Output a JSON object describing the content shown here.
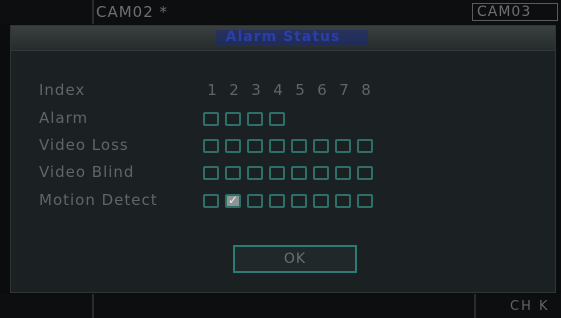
{
  "topbar": {
    "cam_left": "CAM02 *",
    "cam_right": "CAM03"
  },
  "dialog": {
    "title": "Alarm Status",
    "index_label": "Index",
    "indices": [
      "1",
      "2",
      "3",
      "4",
      "5",
      "6",
      "7",
      "8"
    ],
    "rows": [
      {
        "label": "Alarm",
        "checked": [
          false,
          false,
          false,
          false
        ]
      },
      {
        "label": "Video Loss",
        "checked": [
          false,
          false,
          false,
          false,
          false,
          false,
          false,
          false
        ]
      },
      {
        "label": "Video Blind",
        "checked": [
          false,
          false,
          false,
          false,
          false,
          false,
          false,
          false
        ]
      },
      {
        "label": "Motion Detect",
        "checked": [
          false,
          true,
          false,
          false,
          false,
          false,
          false,
          false
        ]
      }
    ],
    "ok_label": "OK"
  },
  "bottombar": {
    "right_text": "CH K"
  },
  "colors": {
    "accent_border": "#2e6f6a",
    "title_text": "#2b3fa8",
    "label_text": "#5e6667"
  }
}
